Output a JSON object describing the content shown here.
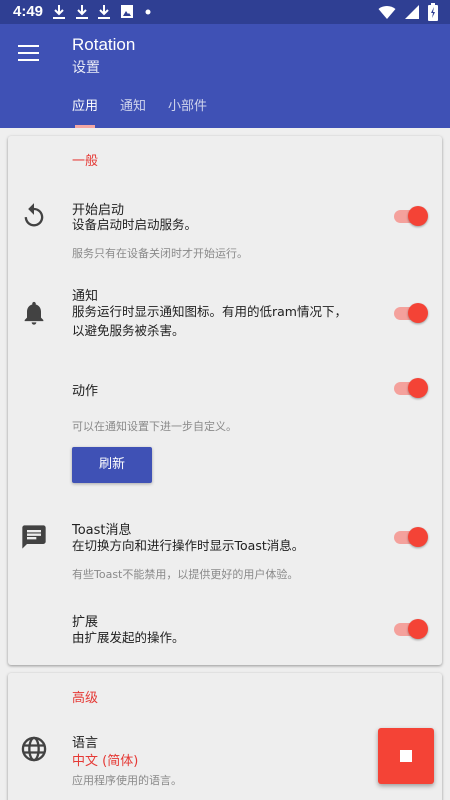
{
  "status_bar": {
    "time": "4:49",
    "notification_icons": [
      "download-icon",
      "download-icon",
      "download-icon",
      "image-icon",
      "dot-icon"
    ],
    "system_icons": [
      "wifi-icon",
      "signal-icon",
      "battery-icon"
    ]
  },
  "app_bar": {
    "menu_icon": "menu-icon",
    "title": "Rotation",
    "subtitle": "设置",
    "tabs": [
      {
        "label": "应用",
        "active": true
      },
      {
        "label": "通知",
        "active": false
      },
      {
        "label": "小部件",
        "active": false
      }
    ]
  },
  "general": {
    "section_title": "一般",
    "start": {
      "icon": "restart-icon",
      "title": "开始启动",
      "summary": "设备启动时启动服务。",
      "note": "服务只有在设备关闭时才开始运行。",
      "enabled": true
    },
    "notification": {
      "icon": "bell-icon",
      "title": "通知",
      "summary_line1": "服务运行时显示通知图标。有用的低ram情况下，",
      "summary_line2": "以避免服务被杀害。",
      "enabled": true
    },
    "action": {
      "title": "动作",
      "note": "可以在通知设置下进一步自定义。",
      "button_label": "刷新",
      "enabled": true
    },
    "toast": {
      "icon": "message-icon",
      "title": "Toast消息",
      "summary": "在切换方向和进行操作时显示Toast消息。",
      "note": "有些Toast不能禁用，以提供更好的用户体验。",
      "enabled": true
    },
    "extension": {
      "title": "扩展",
      "summary": "由扩展发起的操作。",
      "enabled": true
    }
  },
  "advanced": {
    "section_title": "高级",
    "language": {
      "icon": "globe-icon",
      "title": "语言",
      "value": "中文 (简体)",
      "note": "应用程序使用的语言。"
    }
  },
  "fab": {
    "icon": "stop-icon"
  },
  "colors": {
    "primary": "#3f51b5",
    "primary_dark": "#2f3f93",
    "accent": "#f44336",
    "section_title": "#e53935"
  }
}
